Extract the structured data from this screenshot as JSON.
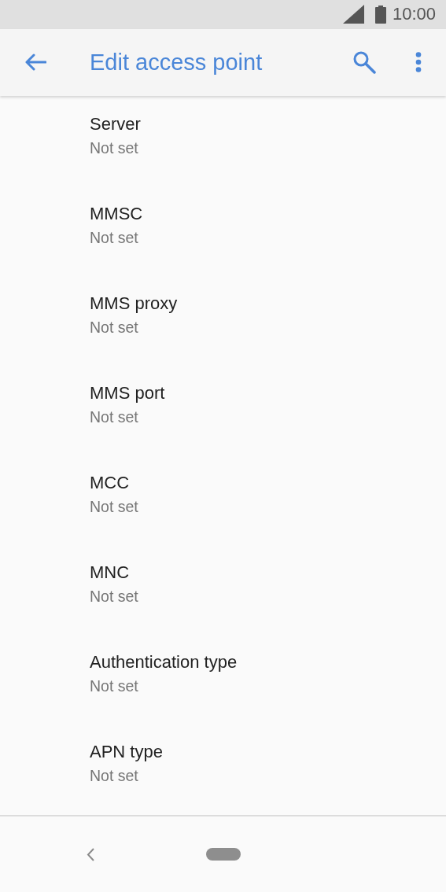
{
  "status_bar": {
    "time": "10:00"
  },
  "app_bar": {
    "title": "Edit access point"
  },
  "settings": [
    {
      "title": "Server",
      "summary": "Not set"
    },
    {
      "title": "MMSC",
      "summary": "Not set"
    },
    {
      "title": "MMS proxy",
      "summary": "Not set"
    },
    {
      "title": "MMS port",
      "summary": "Not set"
    },
    {
      "title": "MCC",
      "summary": "Not set"
    },
    {
      "title": "MNC",
      "summary": "Not set"
    },
    {
      "title": "Authentication type",
      "summary": "Not set"
    },
    {
      "title": "APN type",
      "summary": "Not set"
    }
  ]
}
